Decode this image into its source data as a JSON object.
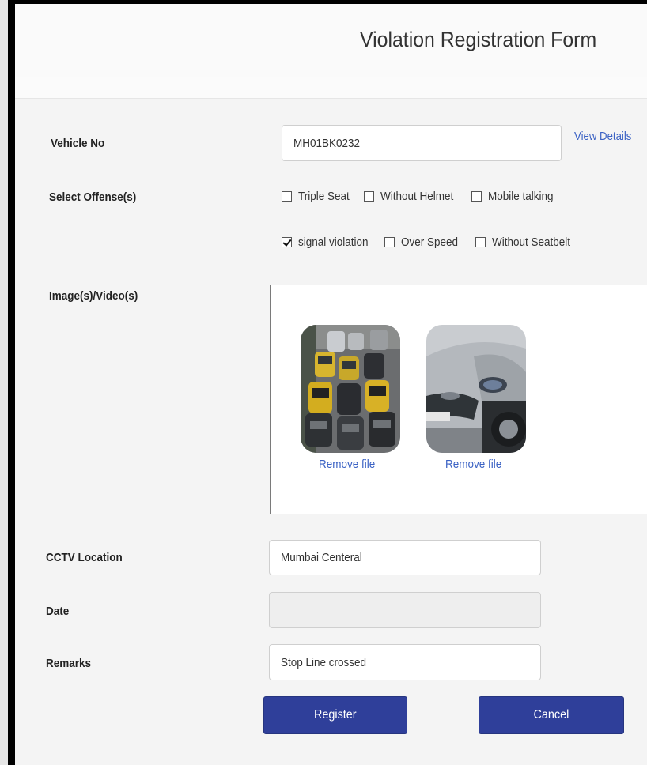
{
  "form": {
    "title": "Violation Registration Form",
    "vehicle_label": "Vehicle No",
    "vehicle_value": "MH01BK0232",
    "view_details": "View Details",
    "offense_label": "Select Offense(s)",
    "offenses": [
      {
        "label": "Triple Seat",
        "checked": false
      },
      {
        "label": "Without Helmet",
        "checked": false
      },
      {
        "label": "Mobile talking",
        "checked": false
      },
      {
        "label": "signal violation",
        "checked": true
      },
      {
        "label": "Over Speed",
        "checked": false
      },
      {
        "label": "Without Seatbelt",
        "checked": false
      }
    ],
    "media_label": "Image(s)/Video(s)",
    "media": [
      {
        "icon": "traffic-photo-icon",
        "remove_label": "Remove file"
      },
      {
        "icon": "car-photo-icon",
        "remove_label": "Remove file"
      }
    ],
    "cctv_label": "CCTV Location",
    "cctv_value": "Mumbai Centeral",
    "date_label": "Date",
    "date_value": "",
    "remarks_label": "Remarks",
    "remarks_value": "Stop Line crossed",
    "register_label": "Register",
    "cancel_label": "Cancel"
  },
  "colors": {
    "accent": "#2f3f9a",
    "link": "#3b62c4"
  }
}
